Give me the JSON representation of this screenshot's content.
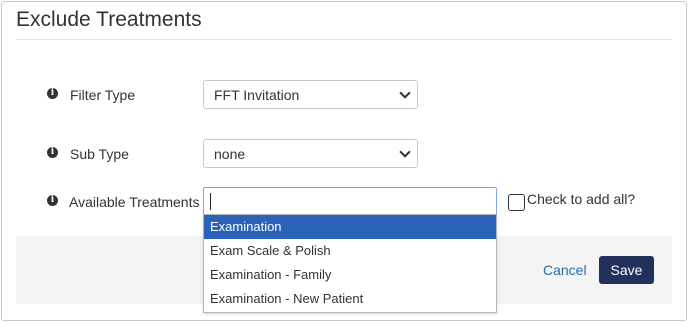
{
  "title": "Exclude Treatments",
  "fields": {
    "filter_type": {
      "label": "Filter Type",
      "value": "FFT Invitation"
    },
    "sub_type": {
      "label": "Sub Type",
      "value": "none"
    },
    "available_treatments": {
      "label": "Available Treatments",
      "value": ""
    }
  },
  "check_all": {
    "label": "Check to add all?"
  },
  "dropdown": {
    "options": [
      {
        "label": "Examination"
      },
      {
        "label": "Exam Scale & Polish"
      },
      {
        "label": "Examination - Family"
      },
      {
        "label": "Examination - New Patient"
      }
    ]
  },
  "footer": {
    "cancel_label": "Cancel",
    "save_label": "Save"
  },
  "info_icon_glyph": "i",
  "colors": {
    "save_button": "#232f5c",
    "link": "#2b6cb0",
    "selected_option": "#2962b8",
    "footer_bg": "#f4f4f4"
  }
}
